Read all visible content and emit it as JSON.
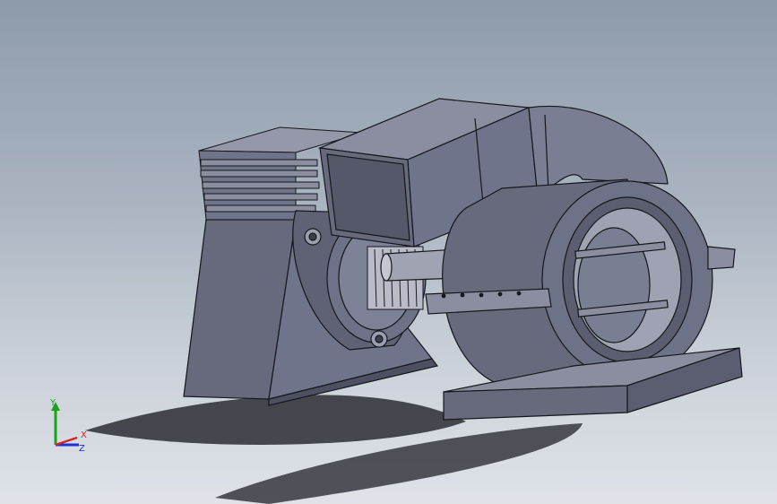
{
  "triad": {
    "labels": {
      "x": "X",
      "y": "Y",
      "z": "Z"
    },
    "colors": {
      "x": "#d8232a",
      "y": "#18a318",
      "z": "#1d2fd6"
    }
  },
  "colors": {
    "background_top": "#8e9bab",
    "background_bottom": "#dfe3e8",
    "model_body": "#666a7c",
    "model_light": "#8a8ea0",
    "model_dark": "#4c5060",
    "edge": "#15171c",
    "shadow": "#2a2d33"
  }
}
